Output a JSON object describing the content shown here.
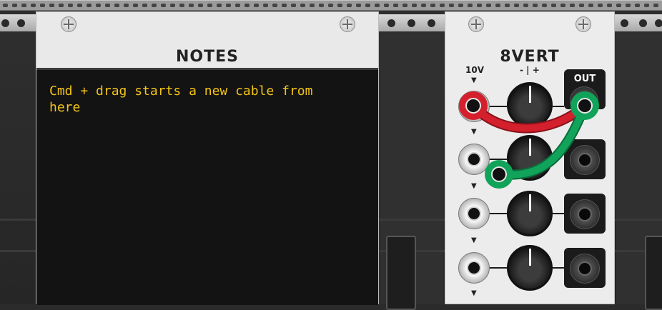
{
  "notes_module": {
    "title": "NOTES",
    "text": "Cmd + drag starts a new cable from\nhere"
  },
  "vert_module": {
    "title": "8VERT",
    "input_label": "10V",
    "gain_label": "- | +",
    "output_label": "OUT",
    "channel_arrow": "▼"
  },
  "cables": [
    {
      "color": "#d4202c",
      "from": "row1-input",
      "to": "row1-output"
    },
    {
      "color": "#11a35a",
      "from": "row2-input",
      "to": "row1-output"
    }
  ],
  "colors": {
    "note_text": "#f3c417",
    "panel": "#ececec",
    "screen": "#131313"
  }
}
